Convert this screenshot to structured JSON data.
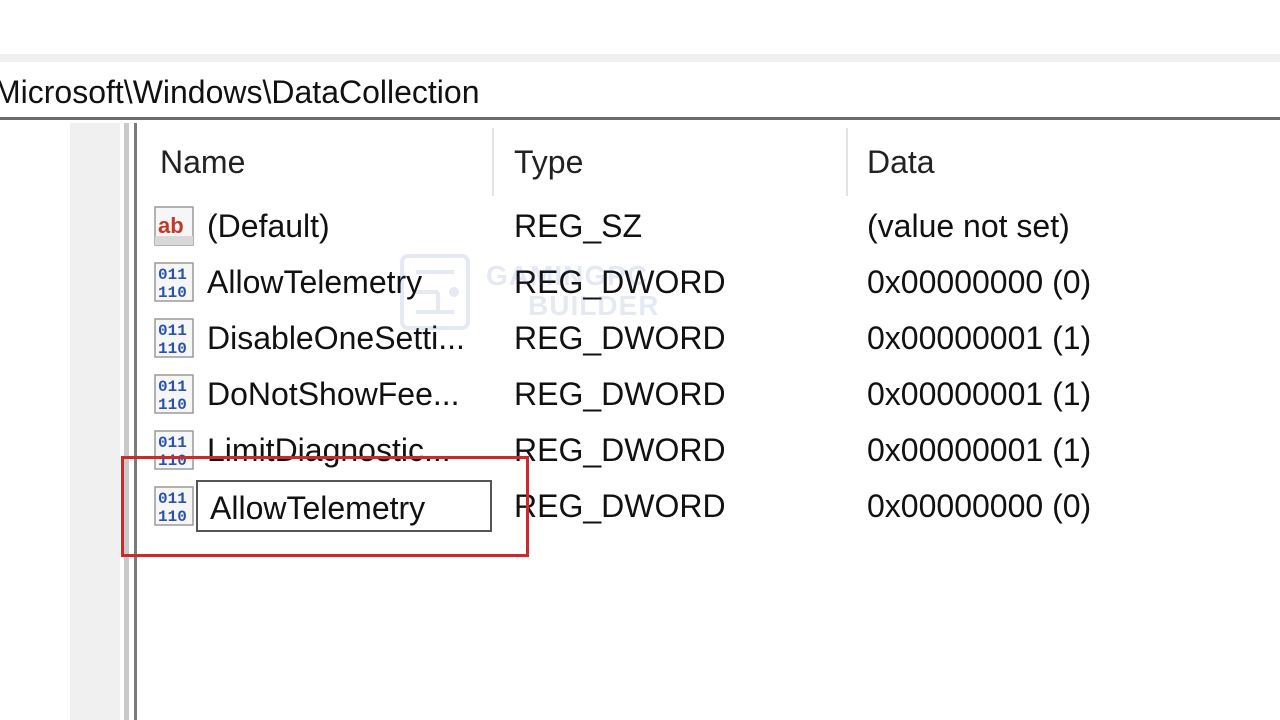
{
  "address": {
    "path": "Microsoft\\Windows\\DataCollection"
  },
  "columns": {
    "name": "Name",
    "type": "Type",
    "data": "Data"
  },
  "rows": [
    {
      "name": "(Default)",
      "type": "REG_SZ",
      "data": "(value not set)",
      "icon": "string-value-icon"
    },
    {
      "name": "AllowTelemetry",
      "type": "REG_DWORD",
      "data": "0x00000000 (0)",
      "icon": "dword-value-icon"
    },
    {
      "name": "DisableOneSetti...",
      "type": "REG_DWORD",
      "data": "0x00000001 (1)",
      "icon": "dword-value-icon"
    },
    {
      "name": "DoNotShowFee...",
      "type": "REG_DWORD",
      "data": "0x00000001 (1)",
      "icon": "dword-value-icon"
    },
    {
      "name": "LimitDiagnostic...",
      "type": "REG_DWORD",
      "data": "0x00000001 (1)",
      "icon": "dword-value-icon"
    },
    {
      "name": "AllowTelemetry",
      "type": "REG_DWORD",
      "data": "0x00000000 (0)",
      "icon": "dword-value-icon",
      "editing": true
    }
  ],
  "watermark": {
    "line1": "GAMINGPC",
    "line2": "BUILDER"
  },
  "colors": {
    "highlight": "#cc2a2a",
    "string_icon": "#c0392b",
    "dword_icon": "#2a52a8"
  }
}
